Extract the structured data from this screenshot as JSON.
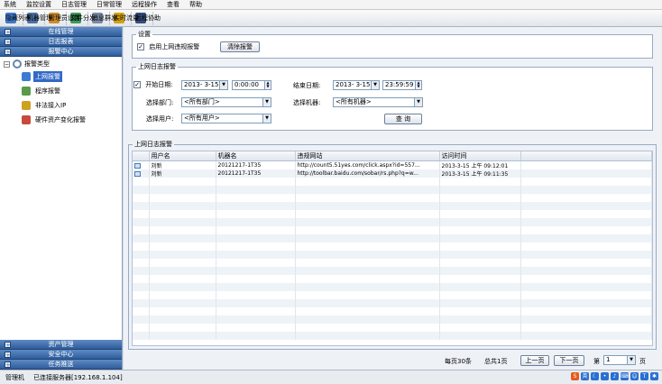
{
  "menubar": [
    "系统",
    "监控设置",
    "日志管理",
    "日常管理",
    "远程操作",
    "查看",
    "帮助"
  ],
  "toolbar": [
    {
      "label": "隐藏列表",
      "color": "#3f78c8"
    },
    {
      "label": "机器管理",
      "color": "#4a6fa5"
    },
    {
      "label": "管理员设置",
      "color": "#d08a2a"
    },
    {
      "label": "文件分发",
      "color": "#3a9a5a"
    },
    {
      "label": "消息群发",
      "color": "#7a8aa5"
    },
    {
      "label": "实时流量",
      "color": "#d4a010"
    },
    {
      "label": "远程协助",
      "color": "#334e7a"
    }
  ],
  "sidebar": {
    "top_sections": [
      "在线管理",
      "日志报表",
      "报警中心"
    ],
    "tree_root": "报警类型",
    "tree_items": [
      {
        "label": "上网报警",
        "selected": true,
        "color": "#3a7bd5"
      },
      {
        "label": "程序报警",
        "selected": false,
        "color": "#5a9a4a"
      },
      {
        "label": "非法接入IP",
        "selected": false,
        "color": "#d0a020"
      },
      {
        "label": "硬件资产变化报警",
        "selected": false,
        "color": "#c84a3a"
      }
    ],
    "bottom_sections": [
      "资产管理",
      "安全中心",
      "任务推送"
    ]
  },
  "settings": {
    "legend": "设置",
    "enable_label": "启用上网违规报警",
    "enable_checked": "✓",
    "clear_button": "清除报警"
  },
  "filter": {
    "legend": "上网日志报警",
    "start_checked": "✓",
    "start_label": "开始日期:",
    "start_date": "2013- 3-15",
    "start_time": "0:00:00",
    "end_label": "结束日期:",
    "end_date": "2013- 3-15",
    "end_time": "23:59:59",
    "dept_label": "选择部门:",
    "dept_value": "<所有部门>",
    "machine_label": "选择机器:",
    "machine_value": "<所有机器>",
    "user_label": "选择用户:",
    "user_value": "<所有用户>",
    "query_button": "查 询"
  },
  "results": {
    "legend": "上网日志报警",
    "columns": [
      "",
      "用户名",
      "机器名",
      "违规网站",
      "访问时间"
    ],
    "rows": [
      {
        "user": "刘新",
        "machine": "20121217-1T35",
        "site": "http://count5.51yes.com/click.aspx?id=557...",
        "time": "2013-3-15 上午 09:12:01"
      },
      {
        "user": "刘新",
        "machine": "20121217-1T35",
        "site": "http://toolbar.baidu.com/sobar/rs.php?q=w...",
        "time": "2013-3-15 上午 09:11:35"
      }
    ]
  },
  "pager": {
    "per_page": "每页30条",
    "total": "总共1页",
    "prev": "上一页",
    "next": "下一页",
    "page_label": "第",
    "page_value": "1",
    "page_suffix": "页"
  },
  "status": {
    "left": "管理机",
    "connection": "已连接服务器[192.168.1.104]",
    "tray_label": "英"
  }
}
